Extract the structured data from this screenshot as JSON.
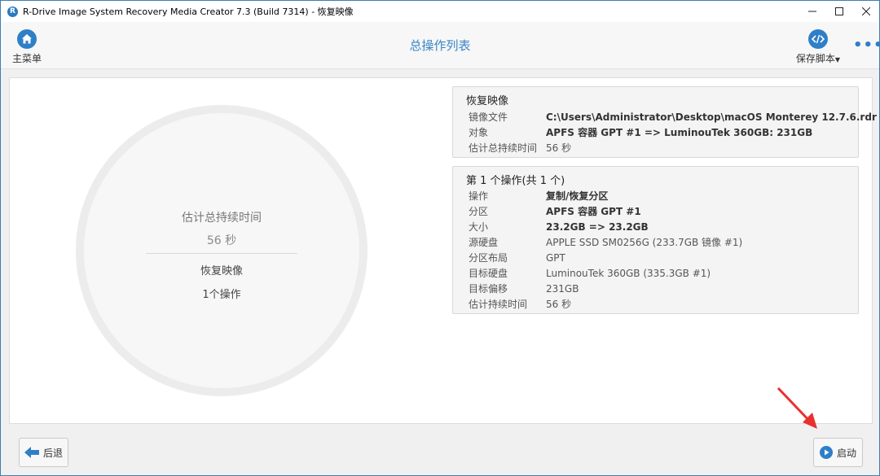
{
  "window": {
    "title": "R-Drive Image System Recovery Media Creator 7.3 (Build 7314) - 恢复映像",
    "app_icon_letter": "R",
    "controls": [
      "minimize-icon",
      "maximize-icon",
      "close-icon"
    ]
  },
  "toolbar": {
    "home_label": "主菜单",
    "home_icon": "home-icon",
    "page_title": "总操作列表",
    "save_script_label": "保存脚本",
    "save_script_icon": "code-icon",
    "more_icon": "more-dots-icon",
    "accent_color": "#2f7fc8"
  },
  "summary": {
    "label": "估计总持续时间",
    "value": "56 秒",
    "operation_name": "恢复映像",
    "operation_count": "1个操作"
  },
  "restore_box": {
    "heading": "恢复映像",
    "rows": [
      {
        "key": "镜像文件",
        "value": "C:\\Users\\Administrator\\Desktop\\macOS Monterey 12.7.6.rdr",
        "bold": true
      },
      {
        "key": "对象",
        "value": "APFS 容器 GPT #1  => LuminouTek 360GB: 231GB",
        "bold": true
      },
      {
        "key": "估计总持续时间",
        "value": "56 秒",
        "bold": false
      }
    ]
  },
  "operation_box": {
    "heading": "第 1 个操作(共 1 个)",
    "rows": [
      {
        "key": "操作",
        "value": "复制/恢复分区",
        "bold": true
      },
      {
        "key": "分区",
        "value": "APFS 容器 GPT #1",
        "bold": true
      },
      {
        "key": "大小",
        "value": "23.2GB => 23.2GB",
        "bold": true
      },
      {
        "key": "源硬盘",
        "value": "APPLE SSD SM0256G (233.7GB 镜像 #1)",
        "bold": false
      },
      {
        "key": "分区布局",
        "value": "GPT",
        "bold": false
      },
      {
        "key": "目标硬盘",
        "value": "LuminouTek 360GB (335.3GB #1)",
        "bold": false
      },
      {
        "key": "目标偏移",
        "value": "231GB",
        "bold": false
      },
      {
        "key": "估计持续时间",
        "value": "56 秒",
        "bold": false
      }
    ]
  },
  "footer": {
    "back_label": "后退",
    "back_icon": "arrow-left-icon",
    "start_label": "启动",
    "start_icon": "play-icon"
  },
  "annotation": {
    "arrow_icon": "red-arrow-icon",
    "arrow_color": "#e8312f"
  }
}
